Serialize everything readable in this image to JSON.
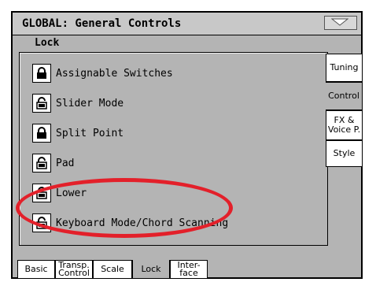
{
  "window": {
    "title": "GLOBAL: General Controls"
  },
  "section": {
    "label": "Lock"
  },
  "lock_items": [
    {
      "label": "Assignable Switches",
      "state": "locked"
    },
    {
      "label": "Slider Mode",
      "state": "unlocked"
    },
    {
      "label": "Split Point",
      "state": "locked"
    },
    {
      "label": "Pad",
      "state": "unlocked"
    },
    {
      "label": "Lower",
      "state": "unlocked"
    },
    {
      "label": "Keyboard Mode/Chord Scanning",
      "state": "unlocked"
    }
  ],
  "side_tabs": [
    {
      "label": "Tuning"
    },
    {
      "label": "Control",
      "active": true
    },
    {
      "label": "FX & Voice P."
    },
    {
      "label": "Style"
    }
  ],
  "bottom_tabs": [
    {
      "label": "Basic"
    },
    {
      "label": "Transp. Control"
    },
    {
      "label": "Scale"
    },
    {
      "label": "Lock",
      "active": true
    },
    {
      "label": "Inter- face"
    }
  ],
  "colors": {
    "panel": "#b4b4b4",
    "highlight_ellipse": "#e3202a"
  }
}
